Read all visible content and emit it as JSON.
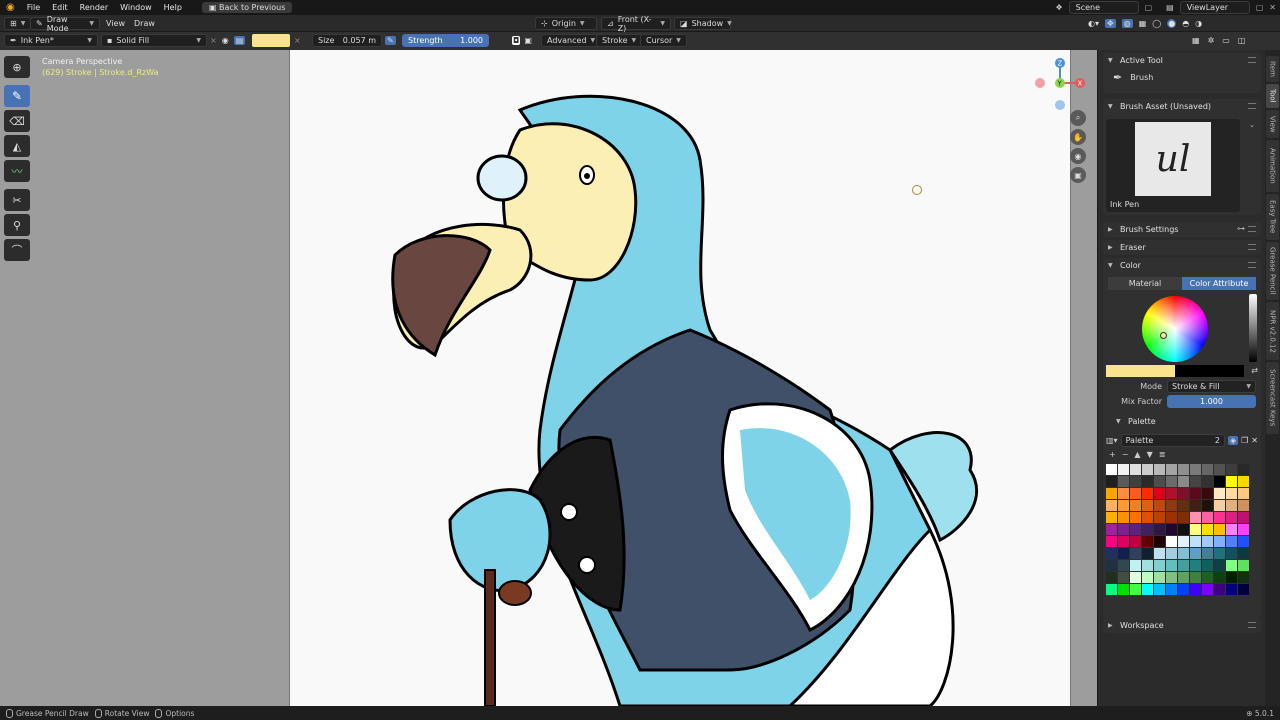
{
  "menubar": {
    "items": [
      "File",
      "Edit",
      "Render",
      "Window",
      "Help"
    ],
    "back_button": "Back to Previous",
    "scene": "Scene",
    "view_layer": "ViewLayer"
  },
  "header": {
    "mode": "Draw Mode",
    "menus": [
      "View",
      "Draw"
    ],
    "pivot": "Origin",
    "view": "Front (X-Z)",
    "shading": "Shadow"
  },
  "tool_settings": {
    "brush": "Ink Pen*",
    "fill_mode": "Solid Fill",
    "size_label": "Size",
    "size_value": "0.057 m",
    "strength_label": "Strength",
    "strength_value": "1.000",
    "advanced": "Advanced",
    "stroke": "Stroke",
    "cursor": "Cursor",
    "color_swatch": "#f9e38d"
  },
  "viewport": {
    "camera_title": "Camera Perspective",
    "camera_sub": "(629) Stroke | Stroke.d_RzWa"
  },
  "sidebar": {
    "active_tool": {
      "title": "Active Tool",
      "tool": "Brush"
    },
    "brush_asset": {
      "title": "Brush Asset (Unsaved)",
      "name": "Ink Pen",
      "preview_text": "ul"
    },
    "brush_settings": "Brush Settings",
    "eraser": "Eraser",
    "color": {
      "title": "Color",
      "tab_material": "Material",
      "tab_color_attribute": "Color Attribute",
      "mode_label": "Mode",
      "mode_value": "Stroke & Fill",
      "mix_label": "Mix Factor",
      "mix_value": "1.000",
      "primary": "#f9e38d",
      "secondary": "#000000"
    },
    "palette": {
      "title": "Palette",
      "name": "Palette",
      "users": "2"
    },
    "workspace": "Workspace",
    "tabs": [
      "Item",
      "Tool",
      "View",
      "Animation",
      "Easy Tree",
      "Grease Pencil",
      "NPR v2.0.12",
      "Screencast Keys"
    ]
  },
  "palette_colors": [
    "#ffffff",
    "#f2f2f2",
    "#e0e0e0",
    "#cccccc",
    "#b8b8b8",
    "#a3a3a3",
    "#8f8f8f",
    "#7a7a7a",
    "#666666",
    "#525252",
    "#3d3d3d",
    "#292929",
    "#1f1f1f",
    "#5a5a5a",
    "#404040",
    "#2a2a2a",
    "#4d4d4d",
    "#6b6b6b",
    "#8a8a8a",
    "#454545",
    "#333333",
    "#000000",
    "#ffff00",
    "#ffd700",
    "#ffa500",
    "#ff8c40",
    "#ff5a1f",
    "#ff2a00",
    "#e0001a",
    "#b0102a",
    "#80102a",
    "#5a0a1a",
    "#3a0a0a",
    "#ffe9c0",
    "#ffd9a0",
    "#ffc880",
    "#ffb060",
    "#ff9a30",
    "#f08020",
    "#e06010",
    "#c04810",
    "#903810",
    "#603010",
    "#402010",
    "#201008",
    "#f0d0a0",
    "#e0b080",
    "#d09060",
    "#ffb000",
    "#ff9000",
    "#ff7000",
    "#e05000",
    "#c04000",
    "#a03000",
    "#803000",
    "#ff90b0",
    "#ff60a0",
    "#ff3090",
    "#e02080",
    "#c01070",
    "#a020a0",
    "#802090",
    "#602080",
    "#402060",
    "#301840",
    "#200830",
    "#101010",
    "#ffff80",
    "#ffe000",
    "#ffc000",
    "#ff80ff",
    "#ff40ff",
    "#ff0080",
    "#e00060",
    "#c00040",
    "#600000",
    "#200000",
    "#ffffff",
    "#e0f0ff",
    "#c0e0ff",
    "#a0c8ff",
    "#80b0ff",
    "#5080ff",
    "#2050ff",
    "#203060",
    "#102050",
    "#304060",
    "#102030",
    "#c0e0f0",
    "#a0d0e0",
    "#80c0d0",
    "#60a0c0",
    "#408090",
    "#207080",
    "#105060",
    "#103840",
    "#203040",
    "#304850",
    "#c0f0f0",
    "#a0e0e0",
    "#80d0d0",
    "#60c0c0",
    "#40a0a0",
    "#208080",
    "#106060",
    "#104040",
    "#80ff80",
    "#60e060",
    "#203020",
    "#405040",
    "#e0ffe0",
    "#c0ffc0",
    "#a0e0a0",
    "#80c080",
    "#60a060",
    "#408040",
    "#206020",
    "#104010",
    "#002000",
    "#103010",
    "#00ff80",
    "#00e000",
    "#40ff40",
    "#00ffff",
    "#00c0ff",
    "#0080ff",
    "#0040ff",
    "#4000ff",
    "#8000ff",
    "#400080",
    "#000080",
    "#000040"
  ],
  "statusbar": {
    "item1": "Grease Pencil Draw",
    "item2": "Rotate View",
    "item3": "Options",
    "version": "5.0.1"
  }
}
